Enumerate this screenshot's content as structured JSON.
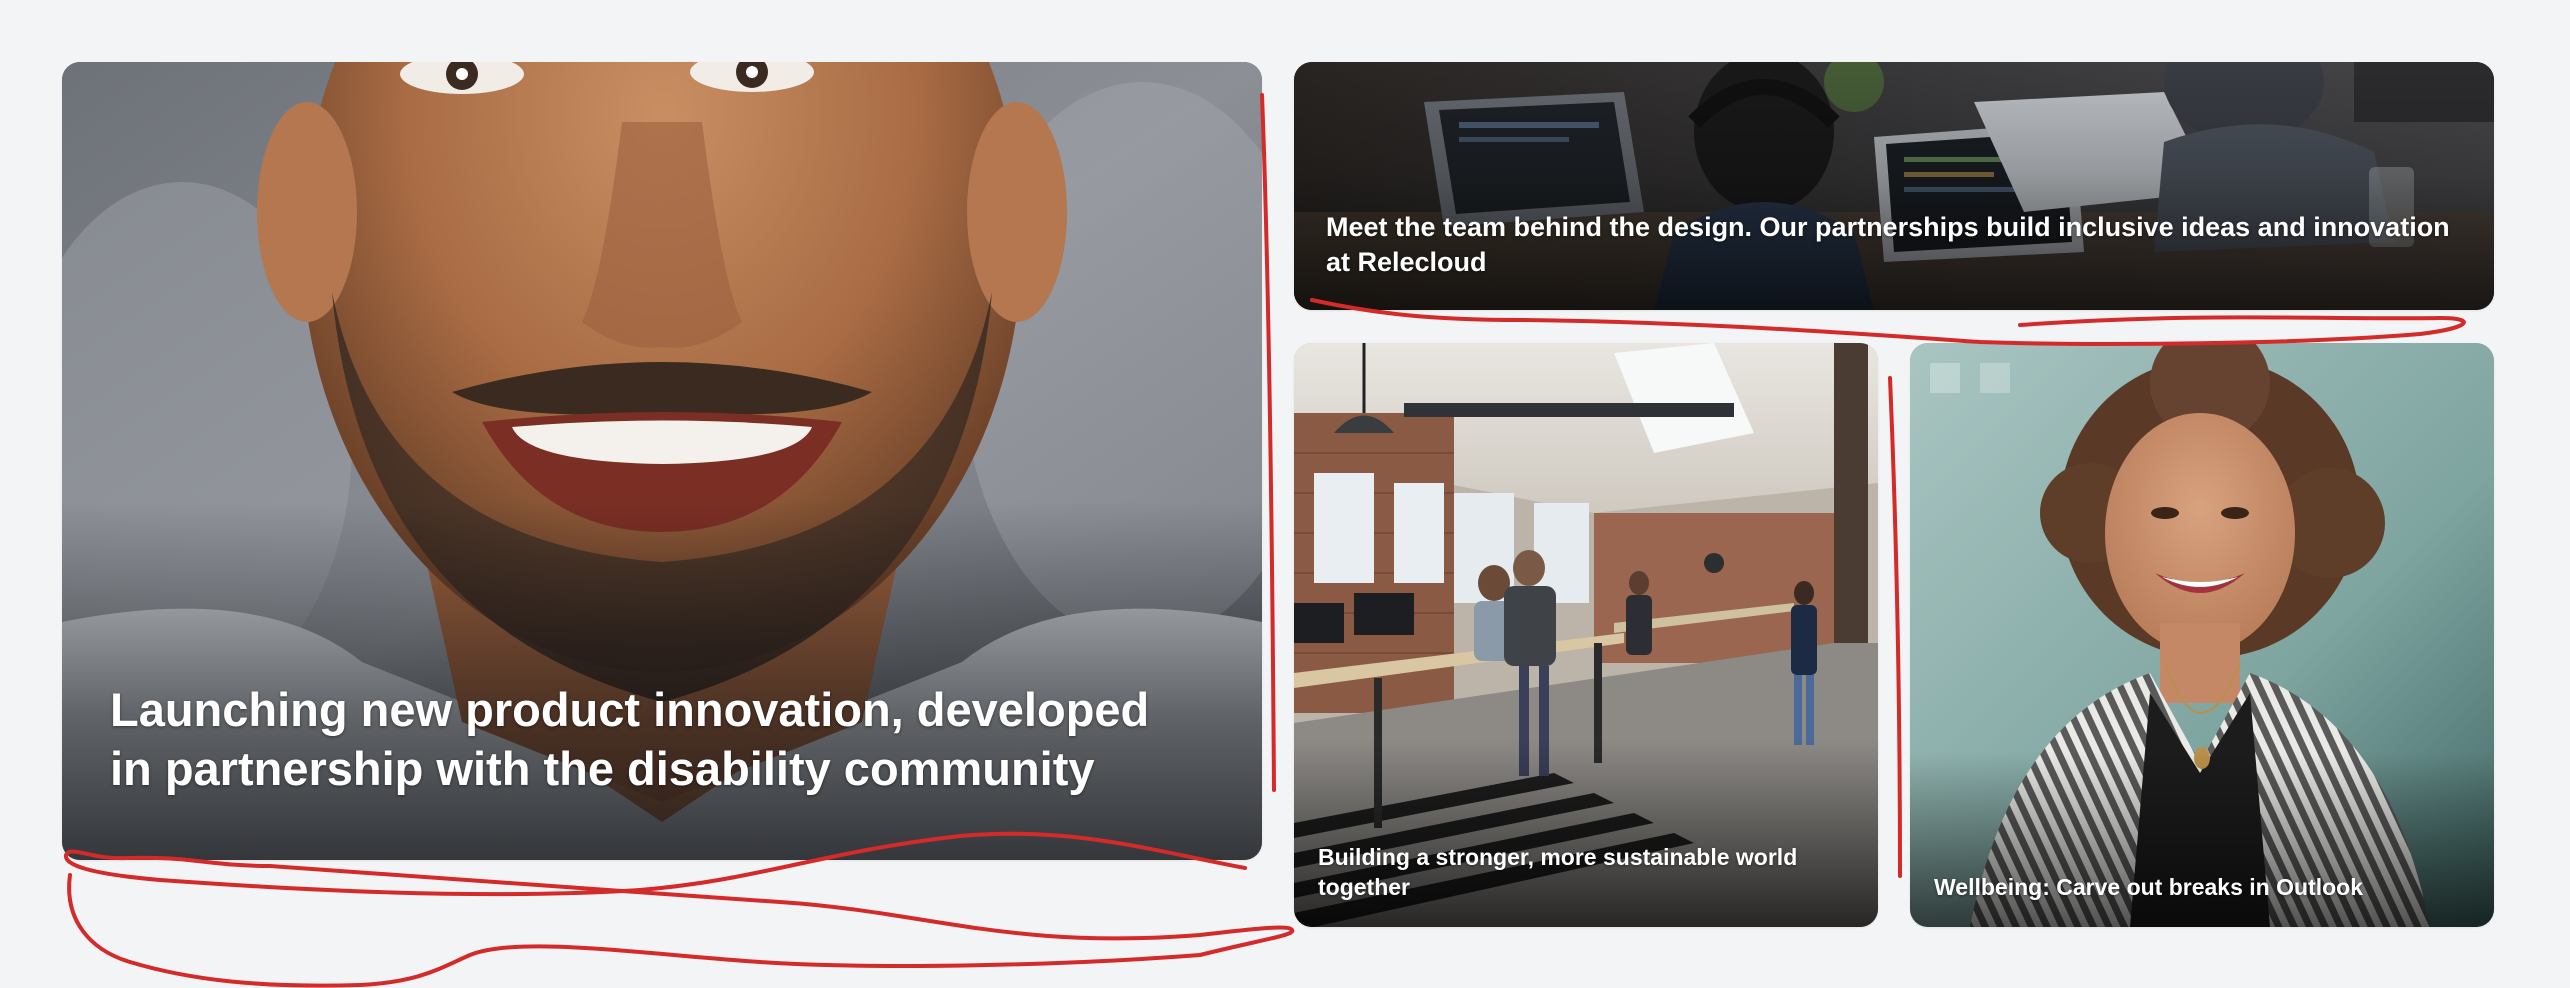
{
  "tiles": {
    "hero": {
      "caption": "Launching new product innovation, developed in partnership with the disability community",
      "image": "smiling-man-portrait"
    },
    "banner": {
      "caption": "Meet the team behind the design. Our partnerships build inclusive ideas and innovation at Relecloud",
      "image": "team-at-laptops"
    },
    "office": {
      "caption": "Building a stronger, more sustainable world together",
      "image": "open-plan-office"
    },
    "wellbeing": {
      "caption": "Wellbeing: Carve out breaks in Outlook",
      "image": "smiling-woman-portrait"
    }
  },
  "colors": {
    "page_background": "#f3f4f6",
    "caption_text": "#ffffff",
    "annotation_ink": "#d42a2a"
  }
}
